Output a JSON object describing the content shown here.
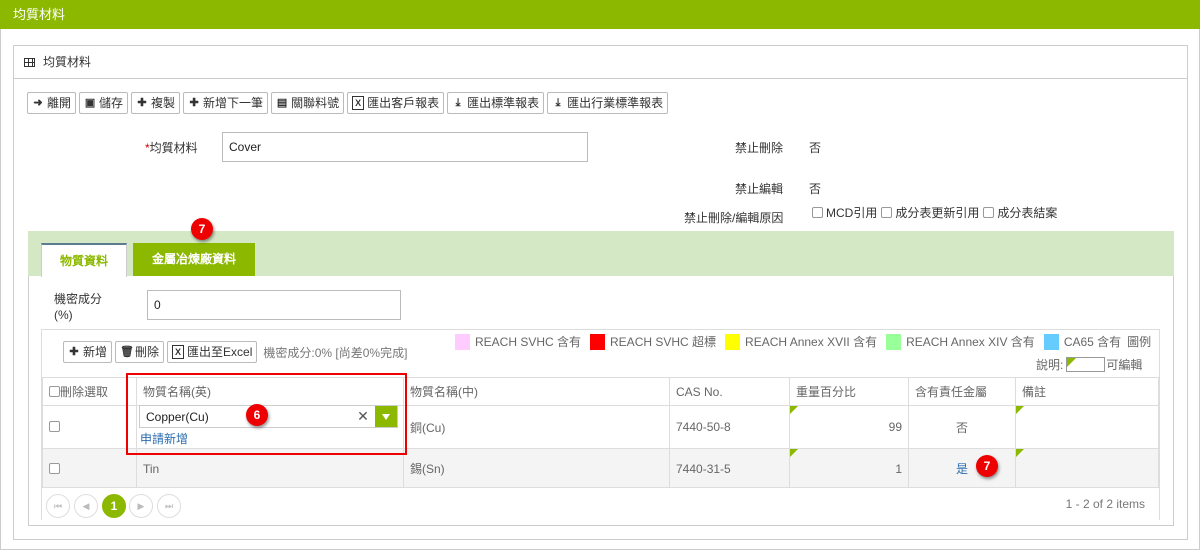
{
  "page": {
    "title": "均質材料"
  },
  "panel": {
    "title": "均質材料",
    "icon": "grid-icon"
  },
  "toolbar": {
    "buttons": [
      {
        "label": "離開",
        "icon": "sign-out-icon"
      },
      {
        "label": "儲存",
        "icon": "save-icon"
      },
      {
        "label": "複製",
        "icon": "plus-icon"
      },
      {
        "label": "新增下一筆",
        "icon": "plus-icon"
      },
      {
        "label": "關聯料號",
        "icon": "document-icon"
      },
      {
        "label": "匯出客戶報表",
        "icon": "excel-icon"
      },
      {
        "label": "匯出標準報表",
        "icon": "download-icon"
      },
      {
        "label": "匯出行業標準報表",
        "icon": "download-icon"
      }
    ]
  },
  "form": {
    "material_label_required": "*",
    "material_label": "均質材料",
    "material_value": "Cover",
    "no_delete_label": "禁止刪除",
    "no_delete_value": "否",
    "no_edit_label": "禁止編輯",
    "no_edit_value": "否",
    "reason_label": "禁止刪除/編輯原因",
    "reason_options": [
      {
        "label": "MCD引用",
        "checked": false
      },
      {
        "label": "成分表更新引用",
        "checked": false
      },
      {
        "label": "成分表結案",
        "checked": false
      }
    ]
  },
  "tabs": [
    {
      "label": "物質資料",
      "active": true
    },
    {
      "label": "金屬冶煉廠資料",
      "active": false,
      "badge": "7"
    }
  ],
  "substance": {
    "secret_label_line1": "機密成分",
    "secret_label_line2": "(%)",
    "secret_value": "0",
    "grid_buttons": [
      {
        "label": "新增",
        "icon": "plus-icon"
      },
      {
        "label": "刪除",
        "icon": "trash-icon"
      },
      {
        "label": "匯出至Excel",
        "icon": "excel-icon"
      }
    ],
    "secret_note": "機密成分:0% [尚差0%完成]",
    "legend": [
      {
        "label": "REACH SVHC 含有",
        "color": "#ffccff"
      },
      {
        "label": "REACH SVHC 超標",
        "color": "#ff0000"
      },
      {
        "label": "REACH Annex XVII 含有",
        "color": "#ffff00"
      },
      {
        "label": "REACH Annex XIV 含有",
        "color": "#99ff99"
      },
      {
        "label": "CA65 含有",
        "color": "#66ccff"
      }
    ],
    "legend_title": "圖例",
    "legend_note_prefix": "說明:",
    "legend_note_suffix": "可編輯",
    "columns": [
      "刪除選取",
      "物質名稱(英)",
      "物質名稱(中)",
      "CAS No.",
      "重量百分比",
      "含有責任金屬",
      "備註"
    ],
    "rows": [
      {
        "name_en": "Copper(Cu)",
        "name_zh": "銅(Cu)",
        "cas": "7440-50-8",
        "weight": "99",
        "conflict_metal": "否",
        "note": ""
      },
      {
        "name_en": "Tin",
        "name_zh": "錫(Sn)",
        "cas": "7440-31-5",
        "weight": "1",
        "conflict_metal": "是",
        "note": ""
      }
    ],
    "apply_new_link": "申請新增",
    "badge_combo": "6",
    "badge_metal": "7"
  },
  "pager": {
    "current_page": "1",
    "info": "1 - 2 of 2 items"
  }
}
